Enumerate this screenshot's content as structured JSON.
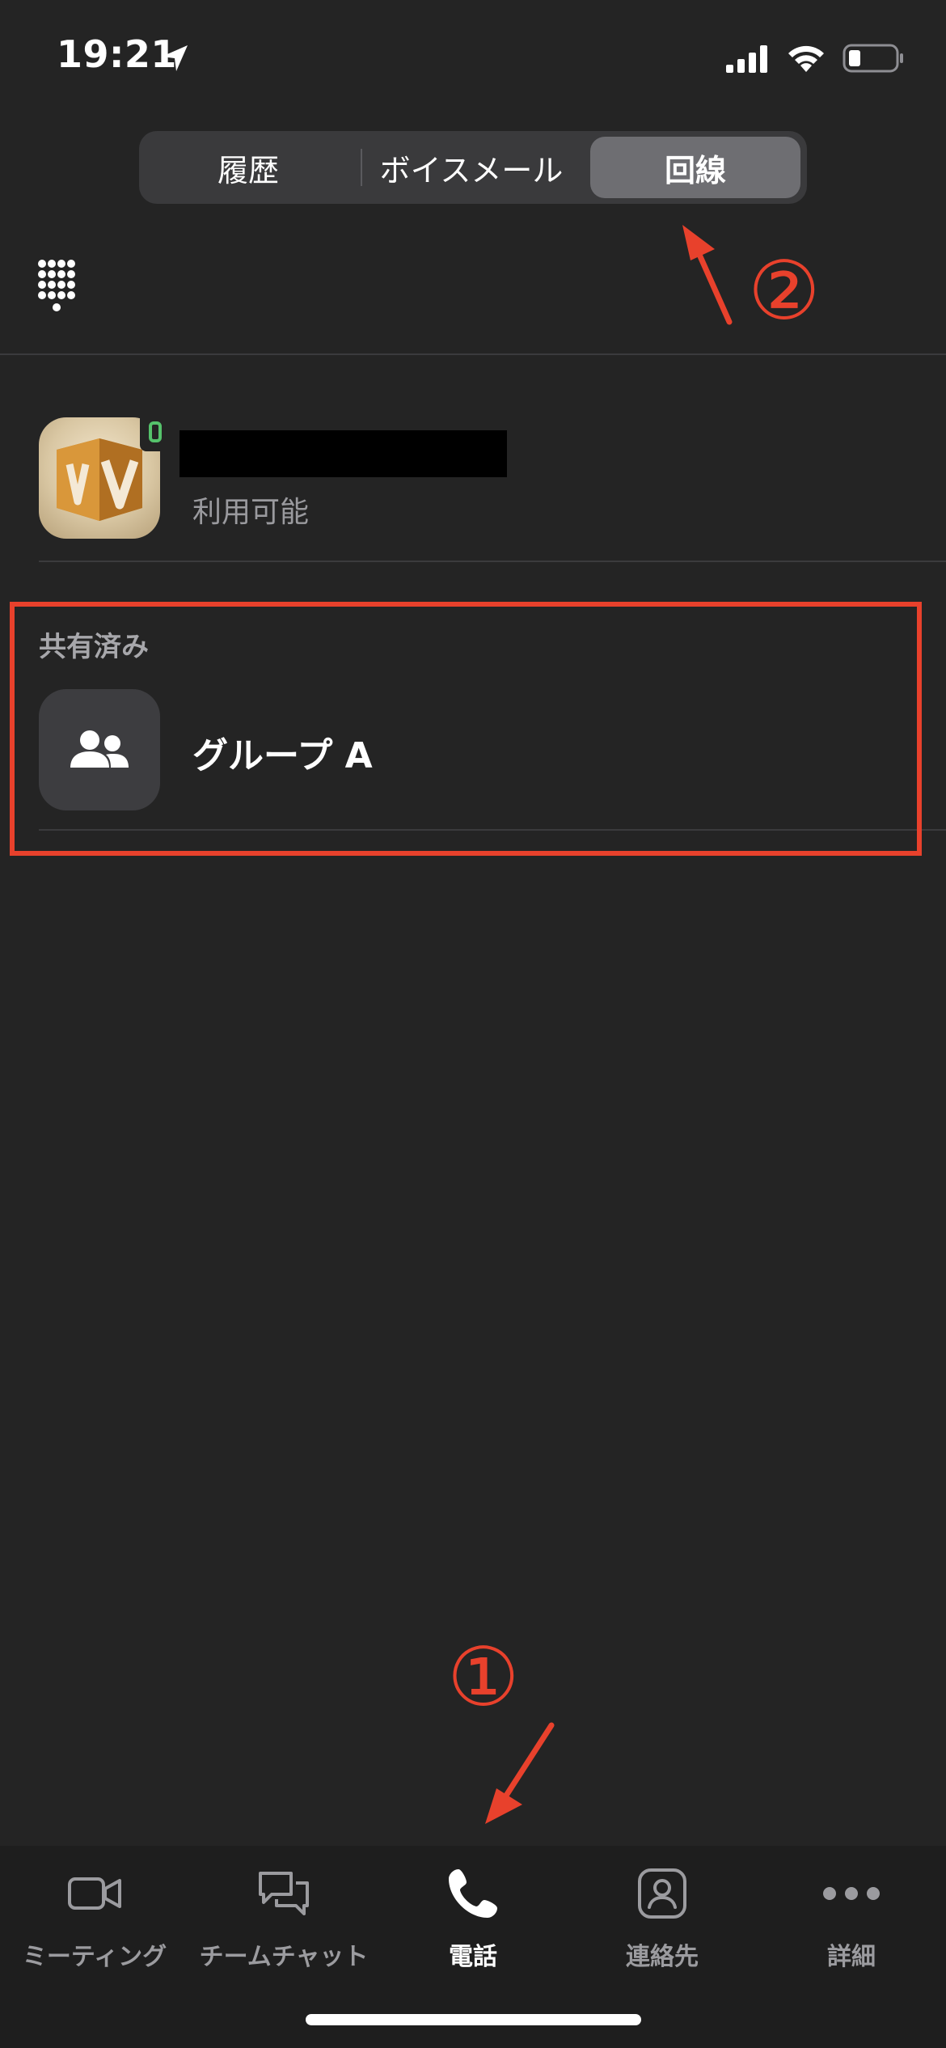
{
  "status_bar": {
    "time": "19:21",
    "battery_level": 0.2
  },
  "segmented": {
    "tabs": [
      {
        "label": "履歴",
        "active": false
      },
      {
        "label": "ボイスメール",
        "active": false
      },
      {
        "label": "回線",
        "active": true
      }
    ]
  },
  "own_line": {
    "status": "利用可能",
    "presence_color": "#55c26b"
  },
  "shared": {
    "title": "共有済み",
    "group_name": "グループ A"
  },
  "annotations": {
    "step1": "①",
    "step2": "②",
    "color": "#e8412c"
  },
  "tabbar": {
    "items": [
      {
        "label": "ミーティング",
        "icon": "video-camera-icon",
        "active": false
      },
      {
        "label": "チームチャット",
        "icon": "chat-bubbles-icon",
        "active": false
      },
      {
        "label": "電話",
        "icon": "phone-icon",
        "active": true
      },
      {
        "label": "連絡先",
        "icon": "contact-card-icon",
        "active": false
      },
      {
        "label": "詳細",
        "icon": "more-dots-icon",
        "active": false
      }
    ]
  }
}
